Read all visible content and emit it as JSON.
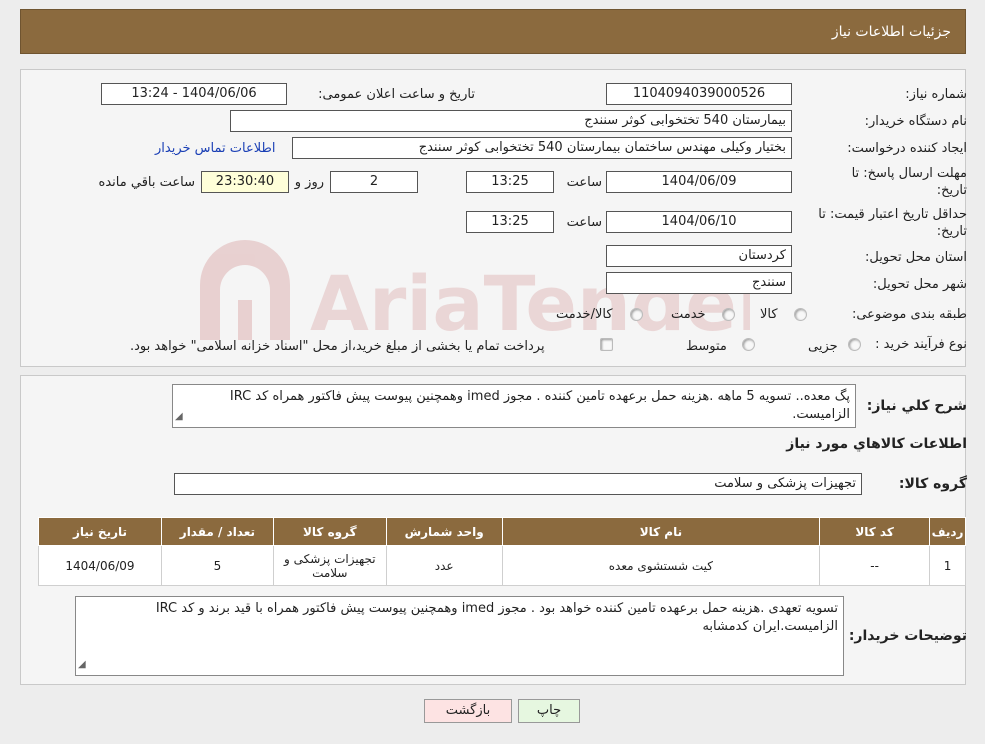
{
  "header": {
    "title": "جزئیات اطلاعات نیاز"
  },
  "watermark": {
    "text": "AriaTender.neT"
  },
  "form": {
    "need_number_label": "شماره نیاز:",
    "need_number": "1104094039000526",
    "announce_label": "تاریخ و ساعت اعلان عمومی:",
    "announce_value": "1404/06/06 - 13:24",
    "buyer_org_label": "نام دستگاه خریدار:",
    "buyer_org": "بیمارستان 540 تختخوابی کوثر سنندج",
    "creator_label": "ایجاد کننده درخواست:",
    "creator": "بختیار وکیلی مهندس ساختمان بیمارستان 540 تختخوابی کوثر سنندج",
    "contact_link": "اطلاعات تماس خریدار",
    "deadline_label_1": "مهلت ارسال پاسخ: تا",
    "deadline_label_2": "تاریخ:",
    "deadline_date": "1404/06/09",
    "time_label": "ساعت",
    "deadline_time": "13:25",
    "days_value": "2",
    "days_label": "روز و",
    "remaining_time": "23:30:40",
    "remaining_label": "ساعت باقي مانده",
    "validity_label_1": "حداقل تاریخ اعتبار قیمت: تا",
    "validity_label_2": "تاریخ:",
    "validity_date": "1404/06/10",
    "validity_time": "13:25",
    "province_label": "استان محل تحویل:",
    "province": "کردستان",
    "city_label": "شهر محل تحویل:",
    "city": "سنندج",
    "category_label": "طبقه بندی موضوعی:",
    "category_options": [
      "کالا",
      "خدمت",
      "کالا/خدمت"
    ],
    "process_label": "نوع فرآیند خرید :",
    "process_options": [
      "جزیی",
      "متوسط"
    ],
    "process_note": "پرداخت تمام یا بخشی از مبلغ خرید،از محل \"اسناد خزانه اسلامی\" خواهد بود."
  },
  "summary": {
    "label": "شرح کلي نياز:",
    "text": "پگ معده.. تسویه 5 ماهه .هزینه حمل برعهده تامین کننده . مجوز imed وهمچنین پیوست پیش فاکتور همراه کد IRC  الزامیست."
  },
  "goods": {
    "section_title": "اطلاعات کالاهاي مورد نياز",
    "group_label": "گروه کالا:",
    "group_value": "تجهیزات پزشکی و سلامت",
    "columns": [
      "رديف",
      "کد کالا",
      "نام کالا",
      "واحد شمارش",
      "گروه کالا",
      "تعداد / مقدار",
      "تاریخ نیاز"
    ],
    "rows": [
      {
        "row": "1",
        "code": "--",
        "name": "کیت شستشوی معده",
        "unit": "عدد",
        "group": "تجهیزات پزشکی و سلامت",
        "qty": "5",
        "date": "1404/06/09"
      }
    ]
  },
  "buyer_notes": {
    "label": "توضیحات خریدار:",
    "text": "تسویه تعهدی .هزینه حمل برعهده تامین کننده خواهد بود . مجوز imed وهمچنین پیوست پیش فاکتور همراه  با قید برند و کد IRC  الزامیست.ایران کدمشابه"
  },
  "buttons": {
    "print": "چاپ",
    "back": "بازگشت"
  },
  "colors": {
    "header": "#8b6a3e",
    "link": "#1a3fb5",
    "highlight": "#ffffd9",
    "back_button": "#fde3e3",
    "print_button": "#e6f7e0"
  }
}
